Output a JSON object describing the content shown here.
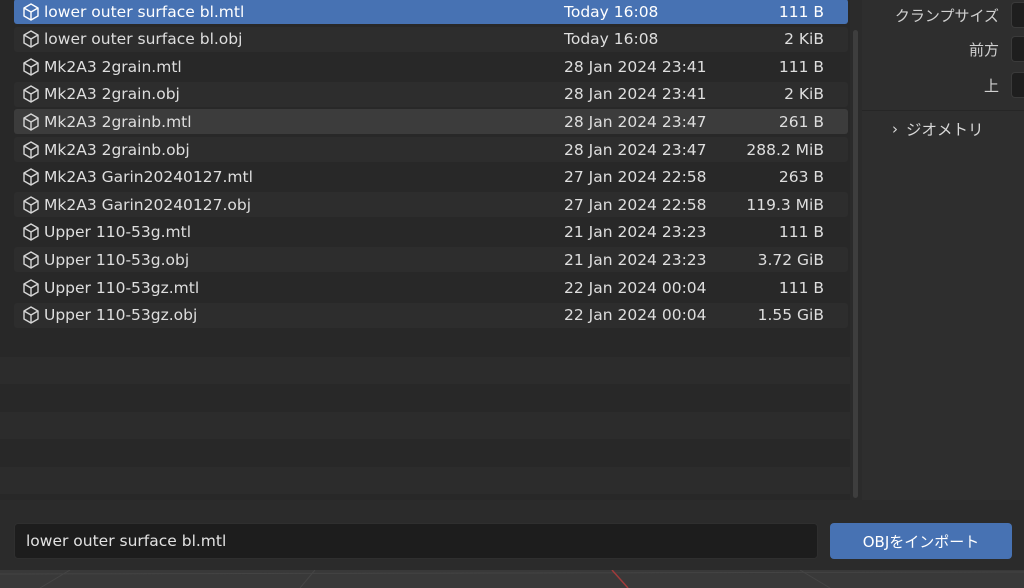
{
  "files": [
    {
      "name": "lower outer surface bl.mtl",
      "date": "Today 16:08",
      "size": "111 B",
      "state": "selected"
    },
    {
      "name": "lower outer surface bl.obj",
      "date": "Today 16:08",
      "size": "2 KiB",
      "state": ""
    },
    {
      "name": "Mk2A3 2grain.mtl",
      "date": "28 Jan 2024 23:41",
      "size": "111 B",
      "state": ""
    },
    {
      "name": "Mk2A3 2grain.obj",
      "date": "28 Jan 2024 23:41",
      "size": "2 KiB",
      "state": ""
    },
    {
      "name": "Mk2A3 2grainb.mtl",
      "date": "28 Jan 2024 23:47",
      "size": "261 B",
      "state": "hovered"
    },
    {
      "name": "Mk2A3 2grainb.obj",
      "date": "28 Jan 2024 23:47",
      "size": "288.2 MiB",
      "state": ""
    },
    {
      "name": "Mk2A3 Garin20240127.mtl",
      "date": "27 Jan 2024 22:58",
      "size": "263 B",
      "state": ""
    },
    {
      "name": "Mk2A3 Garin20240127.obj",
      "date": "27 Jan 2024 22:58",
      "size": "119.3 MiB",
      "state": ""
    },
    {
      "name": "Upper 110-53g.mtl",
      "date": "21 Jan 2024 23:23",
      "size": "111 B",
      "state": ""
    },
    {
      "name": "Upper 110-53g.obj",
      "date": "21 Jan 2024 23:23",
      "size": "3.72 GiB",
      "state": ""
    },
    {
      "name": "Upper 110-53gz.mtl",
      "date": "22 Jan 2024 00:04",
      "size": "111 B",
      "state": ""
    },
    {
      "name": "Upper 110-53gz.obj",
      "date": "22 Jan 2024 00:04",
      "size": "1.55 GiB",
      "state": ""
    }
  ],
  "file_icon": "cube-icon",
  "side_panel": {
    "clamp_size_label": "クランプサイズ",
    "forward_label": "前方",
    "up_label": "上",
    "geometry_label": "ジオメトリ",
    "geometry_chevron": "›"
  },
  "bottom": {
    "filename_value": "lower outer surface bl.mtl",
    "import_button_label": "OBJをインポート"
  },
  "colors": {
    "accent": "#4772b3",
    "panel_bg": "#282828",
    "input_bg": "#1d1d1d"
  }
}
